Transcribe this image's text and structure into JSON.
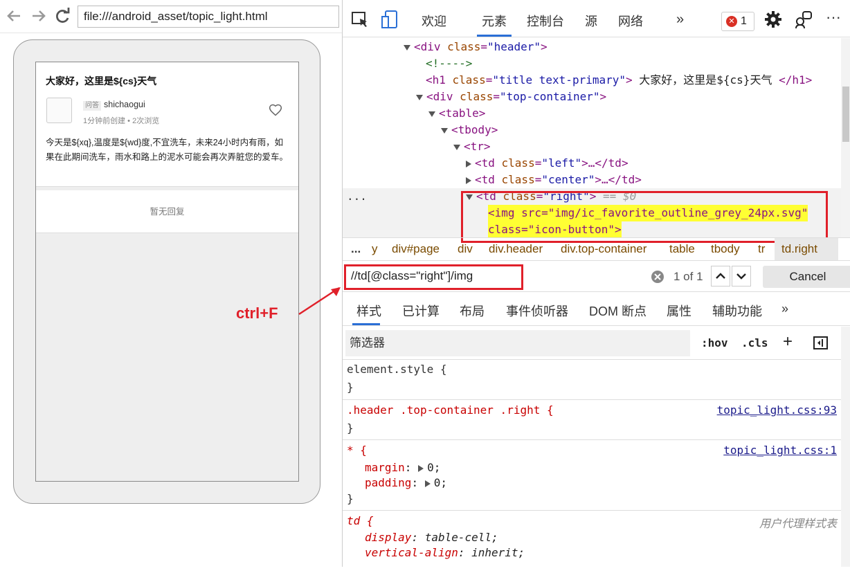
{
  "browser": {
    "url": "file:///android_asset/topic_light.html"
  },
  "phone": {
    "title": "大家好，这里是${cs}天气",
    "tag": "问答",
    "author": "shichaogui",
    "meta": "1分钟前创建 • 2次浏览",
    "body": "今天是${xq},温度是${wd}度,不宜洗车，未来24小时内有雨，如果在此期间洗车，雨水和路上的泥水可能会再次弄脏您的爱车。",
    "reply": "暂无回复"
  },
  "annotation": {
    "label": "ctrl+F",
    "color": "#e0202a"
  },
  "devtools": {
    "tabs": [
      "欢迎",
      "元素",
      "控制台",
      "源",
      "网络"
    ],
    "more": "»",
    "error_count": "1",
    "dom": {
      "l1_tag": "<div ",
      "l1_attr": "class",
      "l1_val": "\"header\"",
      "l1_end": ">",
      "l2_comment": "<!---->",
      "l3_open": "<h1 ",
      "l3_attr": "class",
      "l3_val": "\"title text-primary\"",
      "l3_text": " 大家好，这里是${cs}天气 ",
      "l3_close": "</h1>",
      "l4_tag": "<div ",
      "l4_attr": "class",
      "l4_val": "\"top-container\"",
      "l5": "<table>",
      "l6": "<tbody>",
      "l7": "<tr>",
      "l8_val": "\"left\"",
      "l9_val": "\"center\"",
      "l10_val": "\"right\"",
      "l10_eq": "== $0",
      "td_open": "<td ",
      "td_attr": "class",
      "td_close": ">…</td>",
      "img_line1": "<img src=\"img/ic_favorite_outline_grey_24px.svg\"",
      "img_line2": "class=\"icon-button\">",
      "ellipsis": "..."
    },
    "breadcrumbs": [
      "...",
      "y",
      "div#page",
      "div",
      "div.header",
      "div.top-container",
      "table",
      "tbody",
      "tr",
      "td.right"
    ],
    "search": {
      "value": "//td[@class=\"right\"]/img",
      "count": "1 of 1",
      "cancel": "Cancel"
    },
    "subtabs": [
      "样式",
      "已计算",
      "布局",
      "事件侦听器",
      "DOM 断点",
      "属性",
      "辅助功能",
      "»"
    ],
    "filter": {
      "placeholder": "筛选器",
      "hov": ":hov",
      "cls": ".cls",
      "plus": "+"
    },
    "styles": {
      "r1_sel": "element.style {",
      "r1_end": "}",
      "r2_sel": ".header .top-container .right {",
      "r2_src": "topic_light.css:93",
      "r2_end": "}",
      "r3_sel": "* {",
      "r3_src": "topic_light.css:1",
      "r3_p1": "margin",
      "r3_v1": "0;",
      "r3_p2": "padding",
      "r3_v2": "0;",
      "r3_end": "}",
      "r4_sel": "td {",
      "r4_src": "用户代理样式表",
      "r4_p1": "display",
      "r4_v1": "table-cell;",
      "r4_p2": "vertical-align",
      "r4_v2": "inherit;"
    }
  }
}
